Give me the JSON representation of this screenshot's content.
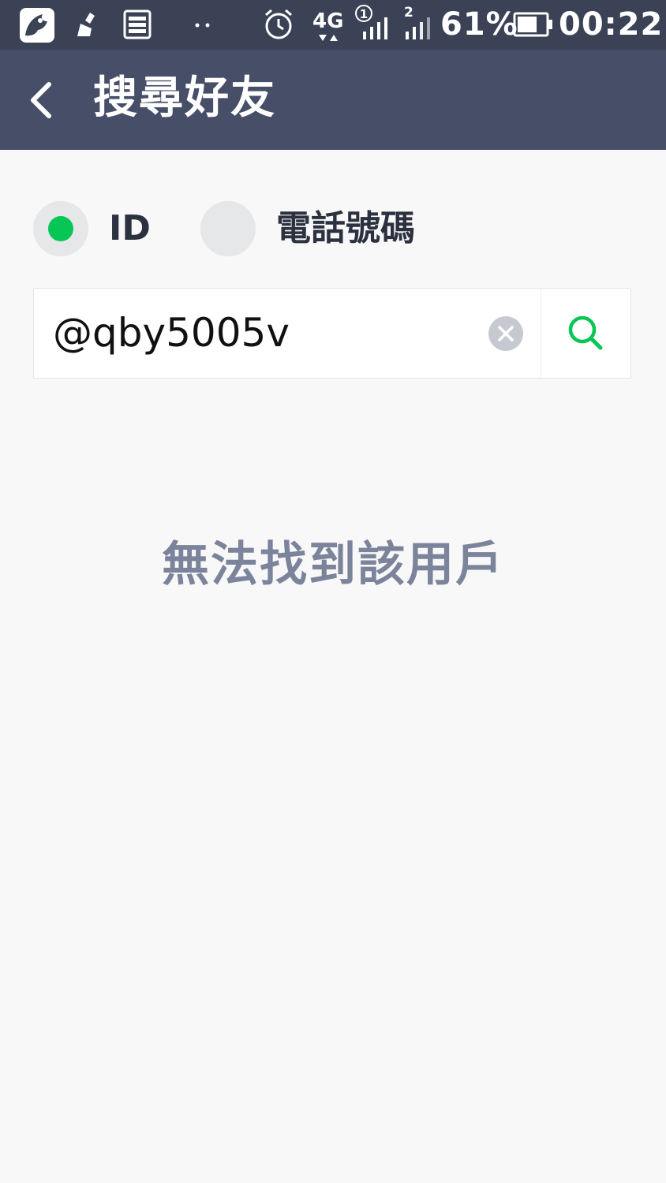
{
  "status_bar": {
    "network": "4G",
    "sim1_label": "1",
    "sim2_label": "2",
    "battery": "61%",
    "time": "00:22",
    "icons": [
      "app-logo-icon",
      "cleaner-icon",
      "storage-icon",
      "more-dots-icon",
      "alarm-icon",
      "network-4g-icon",
      "signal-sim1-icon",
      "signal-sim2-icon",
      "battery-icon"
    ]
  },
  "header": {
    "title": "搜尋好友",
    "back_icon": "chevron-left-icon"
  },
  "search_type": {
    "options": [
      {
        "label": "ID",
        "selected": true
      },
      {
        "label": "電話號碼",
        "selected": false
      }
    ],
    "selected_color": "#06c755"
  },
  "search": {
    "value": "@qby5005v",
    "clear_icon": "clear-icon",
    "search_icon": "search-icon",
    "accent_color": "#06c755"
  },
  "result": {
    "message": "無法找到該用戶"
  }
}
